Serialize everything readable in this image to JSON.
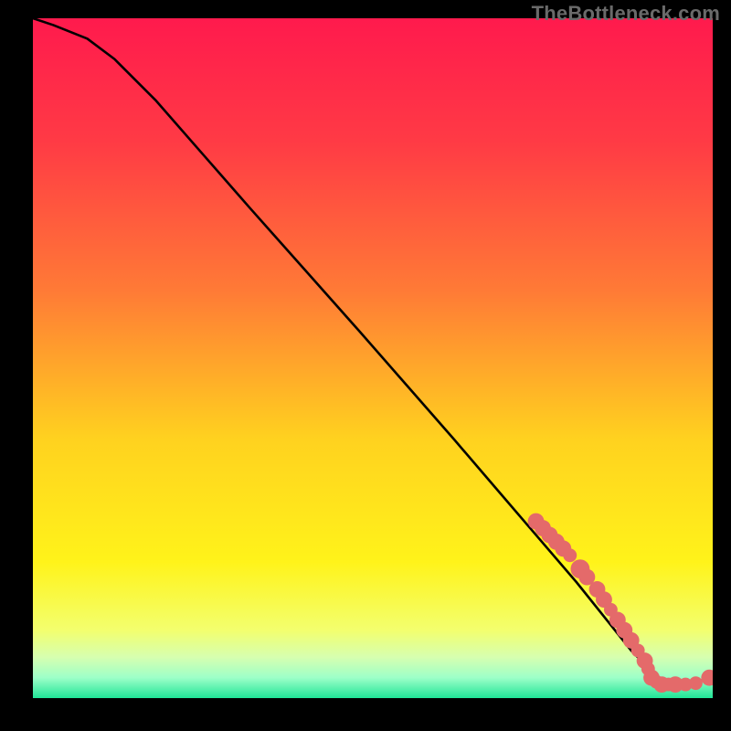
{
  "attribution": "TheBottleneck.com",
  "colors": {
    "background": "#000000",
    "attribution": "#6a6a6a",
    "curve": "#000000",
    "points": "#e46a6a",
    "gradient_stops": [
      {
        "pct": 0,
        "color": "#ff1a4d"
      },
      {
        "pct": 18,
        "color": "#ff3a45"
      },
      {
        "pct": 40,
        "color": "#ff7a36"
      },
      {
        "pct": 62,
        "color": "#ffd21f"
      },
      {
        "pct": 80,
        "color": "#fff31a"
      },
      {
        "pct": 90,
        "color": "#f3ff6e"
      },
      {
        "pct": 94,
        "color": "#d6ffb0"
      },
      {
        "pct": 97,
        "color": "#9dffc8"
      },
      {
        "pct": 100,
        "color": "#20e597"
      }
    ]
  },
  "chart_data": {
    "type": "line",
    "title": "",
    "xlabel": "",
    "ylabel": "",
    "xlim": [
      0,
      100
    ],
    "ylim": [
      0,
      100
    ],
    "grid": false,
    "legend": false,
    "series": [
      {
        "name": "bottleneck-curve",
        "x": [
          0,
          3,
          8,
          12,
          18,
          25,
          32,
          40,
          48,
          55,
          62,
          68,
          74,
          80,
          84,
          88,
          92,
          96,
          100
        ],
        "y": [
          100,
          99,
          97,
          94,
          88,
          80,
          72,
          63,
          54,
          46,
          38,
          31,
          24,
          17,
          12,
          7,
          3,
          2,
          3
        ]
      }
    ],
    "points": [
      {
        "x": 74,
        "y": 26,
        "r": 1.2
      },
      {
        "x": 75,
        "y": 25,
        "r": 1.2
      },
      {
        "x": 76,
        "y": 24,
        "r": 1.2
      },
      {
        "x": 77,
        "y": 23,
        "r": 1.2
      },
      {
        "x": 78,
        "y": 22,
        "r": 1.2
      },
      {
        "x": 79,
        "y": 21,
        "r": 1.0
      },
      {
        "x": 80.5,
        "y": 19,
        "r": 1.4
      },
      {
        "x": 81.5,
        "y": 17.8,
        "r": 1.2
      },
      {
        "x": 83,
        "y": 16,
        "r": 1.2
      },
      {
        "x": 84,
        "y": 14.5,
        "r": 1.2
      },
      {
        "x": 85,
        "y": 13,
        "r": 1.0
      },
      {
        "x": 86,
        "y": 11.5,
        "r": 1.2
      },
      {
        "x": 87,
        "y": 10,
        "r": 1.2
      },
      {
        "x": 88,
        "y": 8.5,
        "r": 1.2
      },
      {
        "x": 89,
        "y": 7,
        "r": 1.0
      },
      {
        "x": 90,
        "y": 5.5,
        "r": 1.2
      },
      {
        "x": 90.5,
        "y": 4.3,
        "r": 1.0
      },
      {
        "x": 91,
        "y": 3.0,
        "r": 1.2
      },
      {
        "x": 91.7,
        "y": 2.4,
        "r": 1.0
      },
      {
        "x": 92.5,
        "y": 2.0,
        "r": 1.2
      },
      {
        "x": 93.5,
        "y": 2.0,
        "r": 1.0
      },
      {
        "x": 94.5,
        "y": 2.0,
        "r": 1.2
      },
      {
        "x": 96,
        "y": 2.0,
        "r": 1.0
      },
      {
        "x": 97.5,
        "y": 2.2,
        "r": 1.0
      },
      {
        "x": 99.5,
        "y": 3.0,
        "r": 1.2
      }
    ]
  }
}
